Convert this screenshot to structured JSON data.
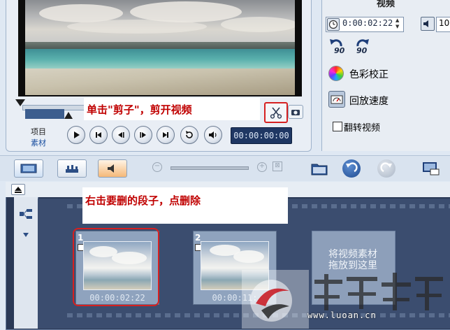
{
  "preview": {
    "cut_callout": "单击\"剪子\"，剪开视频",
    "label_project": "项目",
    "label_clip": "素材",
    "timecode": "00:00:00:00"
  },
  "options": {
    "header": "视频",
    "duration": "0:00:02:22",
    "volume": "10",
    "rotate_left_label": "90",
    "rotate_right_label": "90",
    "color_correction": "色彩校正",
    "playback_speed": "回放速度",
    "reverse_video": "翻转视频"
  },
  "storyboard": {
    "delete_callout": "右击要删的段子，点删除",
    "clips": [
      {
        "number": "1",
        "timecode": "00:00:02:22"
      },
      {
        "number": "2",
        "timecode": "00:00:11:"
      }
    ],
    "drop_hint_line1": "将视频素材",
    "drop_hint_line2": "拖放到这里"
  },
  "watermark": {
    "url": "www.luoan.cn"
  },
  "colors": {
    "accent_red": "#d62020",
    "timecode_bg": "#1f3763",
    "storyboard_bg": "#2a3956"
  }
}
